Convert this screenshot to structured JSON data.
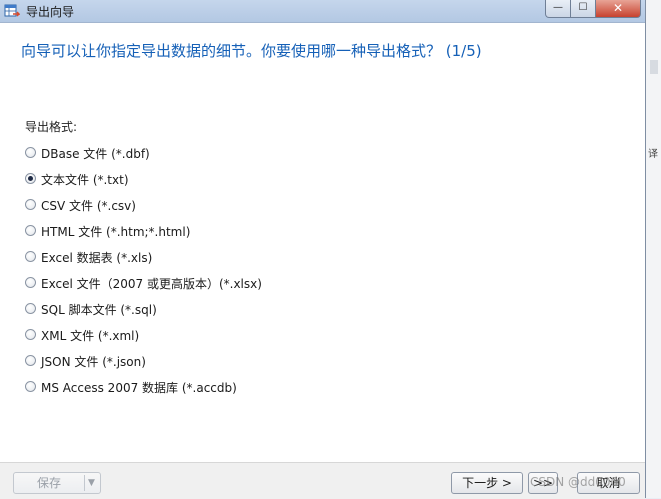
{
  "window": {
    "title": "导出向导",
    "controls": {
      "minimize": "—",
      "maximize": "☐",
      "close": "✕"
    }
  },
  "question": "向导可以让你指定导出数据的细节。你要使用哪一种导出格式？ (1/5)",
  "format_group": {
    "label": "导出格式:",
    "options": [
      {
        "label": "DBase 文件 (*.dbf)",
        "selected": false
      },
      {
        "label": "文本文件 (*.txt)",
        "selected": true
      },
      {
        "label": "CSV 文件 (*.csv)",
        "selected": false
      },
      {
        "label": "HTML 文件 (*.htm;*.html)",
        "selected": false
      },
      {
        "label": "Excel 数据表 (*.xls)",
        "selected": false
      },
      {
        "label": "Excel 文件（2007 或更高版本）(*.xlsx)",
        "selected": false
      },
      {
        "label": "SQL 脚本文件 (*.sql)",
        "selected": false
      },
      {
        "label": "XML 文件 (*.xml)",
        "selected": false
      },
      {
        "label": "JSON 文件 (*.json)",
        "selected": false
      },
      {
        "label": "MS Access 2007 数据库 (*.accdb)",
        "selected": false
      }
    ]
  },
  "footer": {
    "save_label": "保存",
    "next_label": "下一步 >",
    "last_label": ">>",
    "cancel_label": "取消"
  },
  "watermark": "CSDN @dd0000",
  "background_mark": "译"
}
